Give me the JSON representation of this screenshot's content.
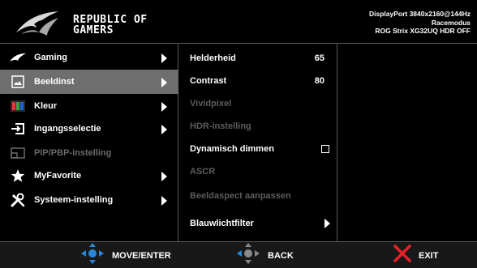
{
  "header": {
    "brand_line1": "REPUBLIC OF",
    "brand_line2": "GAMERS",
    "status_line1": "DisplayPort 3840x2160@144Hz",
    "status_line2": "Racemodus",
    "status_line3": "ROG Strix XG32UQ HDR OFF"
  },
  "menu": {
    "items": [
      {
        "label": "Gaming",
        "icon": "rog-eye-icon",
        "has_submenu": true
      },
      {
        "label": "Beeldinst",
        "icon": "image-icon",
        "has_submenu": true,
        "selected": true
      },
      {
        "label": "Kleur",
        "icon": "color-icon",
        "has_submenu": true
      },
      {
        "label": "Ingangsselectie",
        "icon": "input-icon",
        "has_submenu": true
      },
      {
        "label": "PIP/PBP-instelling",
        "icon": "pip-icon",
        "disabled": true
      },
      {
        "label": "MyFavorite",
        "icon": "star-icon",
        "has_submenu": true
      },
      {
        "label": "Systeem-instelling",
        "icon": "tools-icon",
        "has_submenu": true
      }
    ]
  },
  "submenu": {
    "items": [
      {
        "label": "Helderheid",
        "value": "65"
      },
      {
        "label": "Contrast",
        "value": "80"
      },
      {
        "label": "Vividpixel",
        "disabled": true
      },
      {
        "label": "HDR-instelling",
        "disabled": true
      },
      {
        "label": "Dynamisch dimmen",
        "checkbox": false
      },
      {
        "label": "ASCR",
        "disabled": true
      },
      {
        "label": "Beeldaspect aanpassen",
        "disabled": true
      },
      {
        "label": "Blauwlichtfilter",
        "has_submenu": true
      }
    ]
  },
  "footer": {
    "move_label": "MOVE/ENTER",
    "back_label": "BACK",
    "exit_label": "EXIT"
  },
  "colors": {
    "selected_bg": "#6e6e6e",
    "exit_red": "#e8202a",
    "joystick_blue": "#2a86d8",
    "joystick_gray": "#8a8a8a"
  }
}
